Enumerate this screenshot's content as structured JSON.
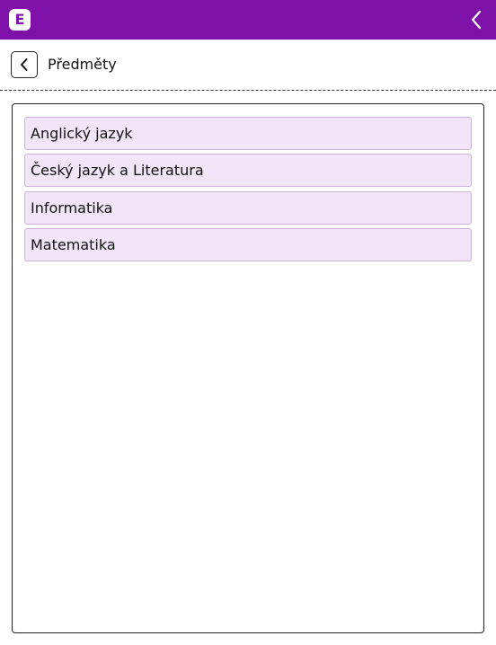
{
  "topbar": {
    "logo_letter": "E",
    "brand_color": "#7e12a8",
    "collapse_icon": "chevron-left-icon"
  },
  "header": {
    "back_icon": "chevron-left-icon",
    "title": "Předměty"
  },
  "subjects": [
    {
      "label": "Anglický jazyk"
    },
    {
      "label": "Český jazyk a Literatura"
    },
    {
      "label": "Informatika"
    },
    {
      "label": "Matematika"
    }
  ],
  "colors": {
    "item_background": "#f1e5f7",
    "item_border": "#cdb3dc"
  }
}
